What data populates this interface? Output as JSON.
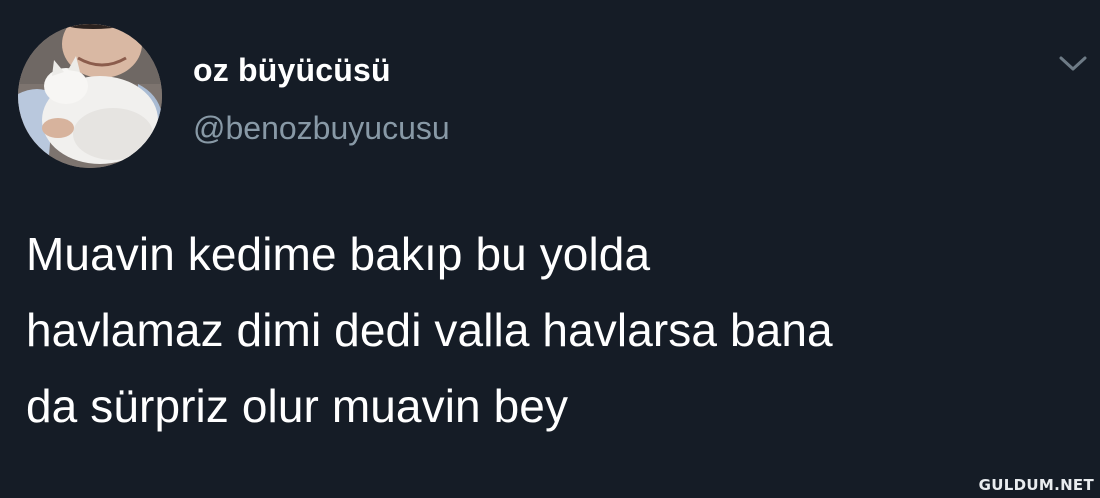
{
  "tweet": {
    "author": {
      "display_name": "oz büyücüsü",
      "handle": "@benozbuyucusu"
    },
    "text_lines": [
      "Muavin kedime bakıp bu yolda",
      "havlamaz dimi dedi valla havlarsa bana",
      "da sürpriz olur muavin bey"
    ],
    "menu_icon": "chevron-down-icon"
  },
  "watermark": "GULDUM.NET",
  "colors": {
    "background": "#151c26",
    "primary_text": "#ffffff",
    "secondary_text": "#8899a6"
  }
}
